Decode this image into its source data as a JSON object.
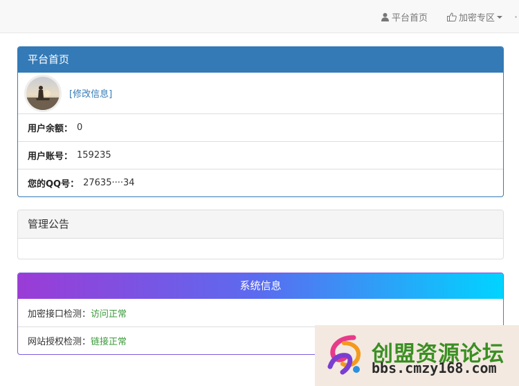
{
  "navbar": {
    "items": [
      {
        "label": "平台首页",
        "icon": "user-icon"
      },
      {
        "label": "加密专区",
        "icon": "thumbs-up-icon",
        "dropdown": true
      }
    ]
  },
  "profile_panel": {
    "title": "平台首页",
    "edit_link": "[修改信息]",
    "rows": [
      {
        "label": "用户余额：",
        "value": "0"
      },
      {
        "label": "用户账号：",
        "value": "159235"
      },
      {
        "label": "您的QQ号：",
        "value": "27635····34"
      }
    ]
  },
  "notice_panel": {
    "title": "管理公告",
    "body": ""
  },
  "system_panel": {
    "title": "系统信息",
    "rows": [
      {
        "label": "加密接口检测：",
        "status": "访问正常"
      },
      {
        "label": "网站授权检测：",
        "status": "链接正常"
      }
    ]
  },
  "watermark": {
    "title": "创盟资源论坛",
    "url": "bbs.cmzy168.com"
  },
  "colors": {
    "primary": "#337ab7",
    "ok": "#3c9a3c",
    "gradient_start": "#9b3bd6",
    "gradient_end": "#00d4ff",
    "watermark_green": "#3a8f22"
  }
}
